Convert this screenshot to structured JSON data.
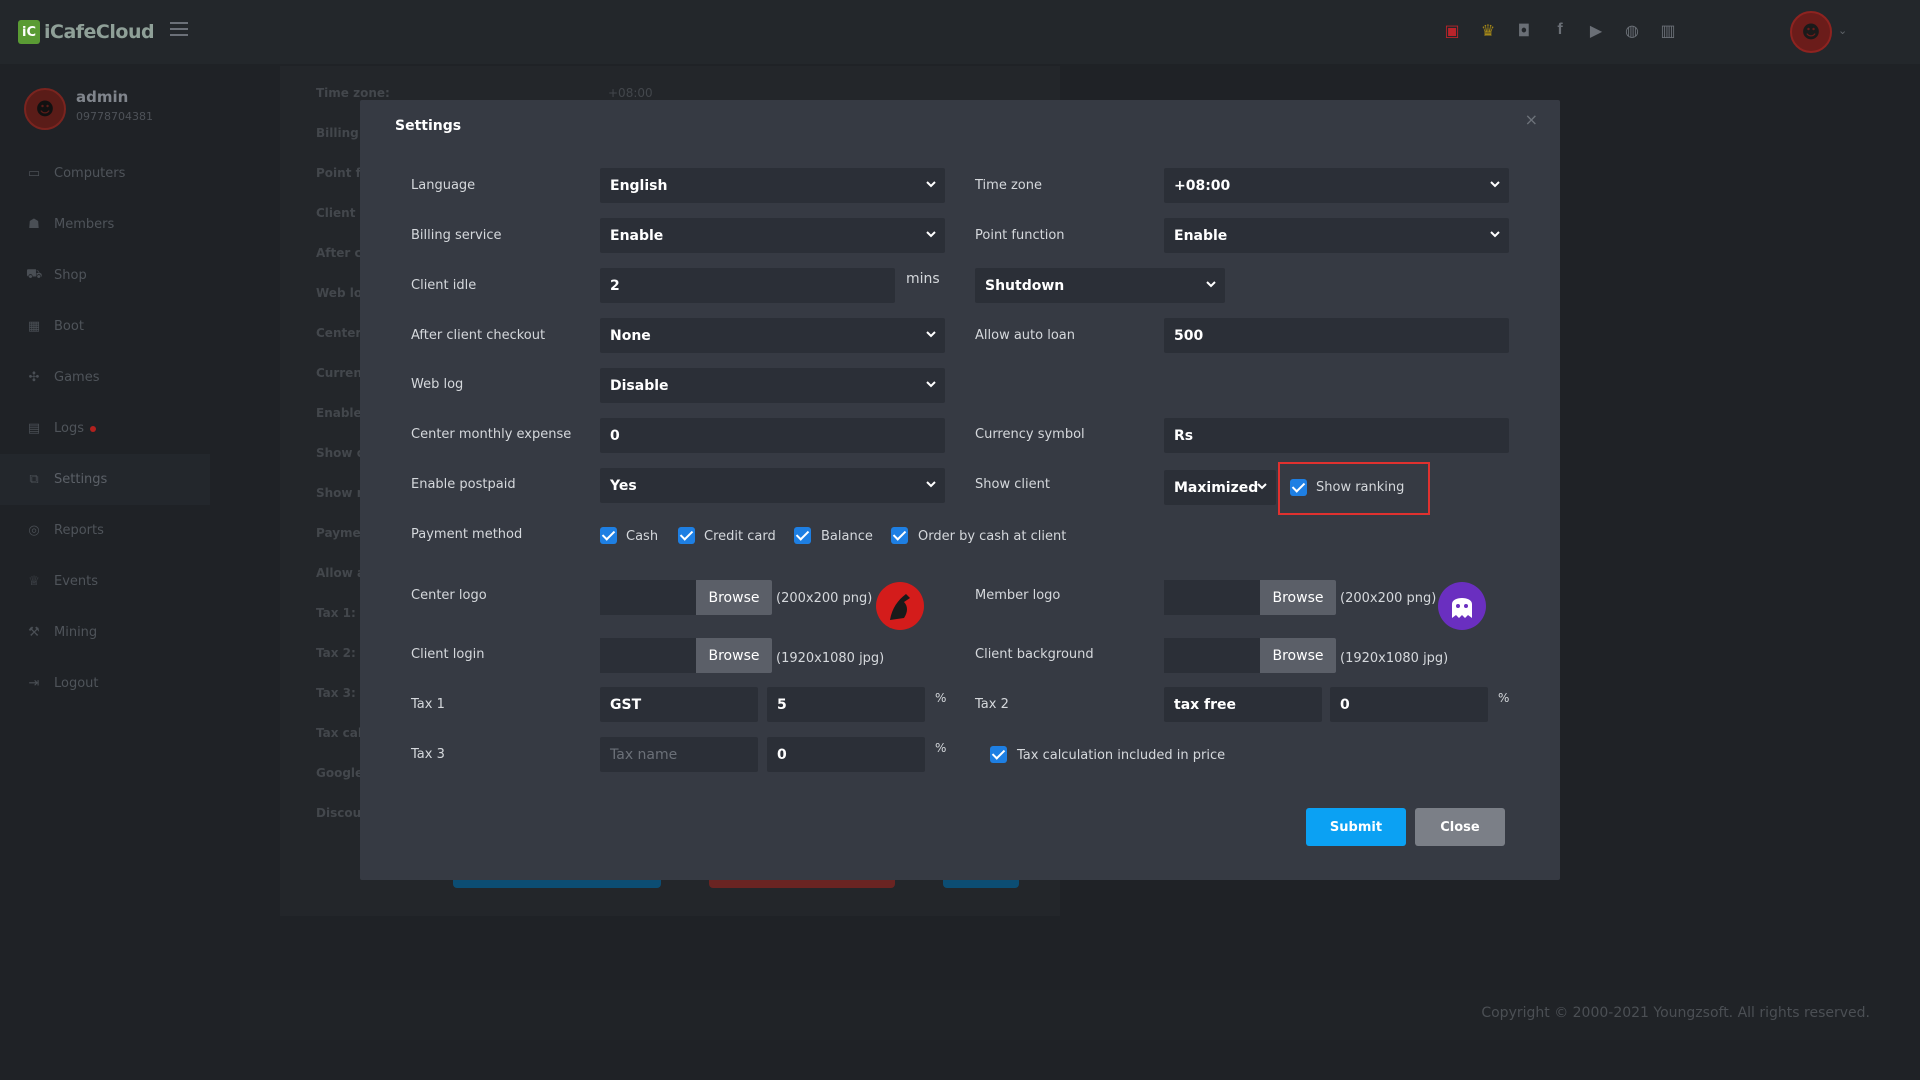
{
  "brand": {
    "logo_mark": "iC",
    "name": "iCafeCloud"
  },
  "topbar": {
    "icons": [
      "gift-icon",
      "trophy-icon",
      "discord-icon",
      "facebook-icon",
      "youtube-icon",
      "globe-icon",
      "book-icon"
    ]
  },
  "user": {
    "name": "admin",
    "phone": "09778704381"
  },
  "sidebar": {
    "items": [
      {
        "label": "Computers",
        "icon": "monitor-icon"
      },
      {
        "label": "Members",
        "icon": "users-icon"
      },
      {
        "label": "Shop",
        "icon": "cart-icon"
      },
      {
        "label": "Boot",
        "icon": "windows-icon"
      },
      {
        "label": "Games",
        "icon": "gamepad-icon"
      },
      {
        "label": "Logs",
        "icon": "calendar-icon"
      },
      {
        "label": "Settings",
        "icon": "settings-icon"
      },
      {
        "label": "Reports",
        "icon": "report-icon"
      },
      {
        "label": "Events",
        "icon": "crown-icon"
      },
      {
        "label": "Mining",
        "icon": "pickaxe-icon"
      },
      {
        "label": "Logout",
        "icon": "logout-icon"
      }
    ],
    "active": "Settings"
  },
  "background": {
    "labels": [
      "Time zone:",
      "Billing",
      "Point fu",
      "Client i",
      "After c",
      "Web lo",
      "Center",
      "Curren",
      "Enable",
      "Show c",
      "Show r",
      "Payme",
      "Allow a",
      "Tax 1:",
      "Tax 2:",
      "Tax 3:",
      "Tax cal",
      "Google",
      "Discou"
    ],
    "timezone_value": "+08:00"
  },
  "footer": {
    "copyright": "Copyright © 2000-2021 Youngzsoft. All rights reserved."
  },
  "modal": {
    "title": "Settings",
    "close_icon": "×",
    "language": {
      "label": "Language",
      "value": "English"
    },
    "timezone": {
      "label": "Time zone",
      "value": "+08:00"
    },
    "billing_service": {
      "label": "Billing service",
      "value": "Enable"
    },
    "point_function": {
      "label": "Point function",
      "value": "Enable"
    },
    "client_idle": {
      "label": "Client idle",
      "value": "2",
      "unit": "mins",
      "action": "Shutdown"
    },
    "after_checkout": {
      "label": "After client checkout",
      "value": "None"
    },
    "auto_loan": {
      "label": "Allow auto loan",
      "value": "500"
    },
    "web_log": {
      "label": "Web log",
      "value": "Disable"
    },
    "monthly_expense": {
      "label": "Center monthly expense",
      "value": "0"
    },
    "currency_symbol": {
      "label": "Currency symbol",
      "value": "Rs"
    },
    "postpaid": {
      "label": "Enable postpaid",
      "value": "Yes"
    },
    "show_client": {
      "label": "Show client",
      "value": "Maximized",
      "show_ranking_label": "Show ranking",
      "show_ranking_checked": true
    },
    "payment": {
      "label": "Payment method",
      "options": [
        {
          "label": "Cash",
          "checked": true
        },
        {
          "label": "Credit card",
          "checked": true
        },
        {
          "label": "Balance",
          "checked": true
        },
        {
          "label": "Order by cash at client",
          "checked": true
        }
      ]
    },
    "center_logo": {
      "label": "Center logo",
      "browse": "Browse",
      "hint": "(200x200 png)"
    },
    "member_logo": {
      "label": "Member logo",
      "browse": "Browse",
      "hint": "(200x200 png)"
    },
    "client_login": {
      "label": "Client login",
      "browse": "Browse",
      "hint": "(1920x1080 jpg)"
    },
    "client_background": {
      "label": "Client background",
      "browse": "Browse",
      "hint": "(1920x1080 jpg)"
    },
    "tax1": {
      "label": "Tax 1",
      "name": "GST",
      "rate": "5",
      "unit": "%"
    },
    "tax2": {
      "label": "Tax 2",
      "name": "tax free",
      "rate": "0",
      "unit": "%"
    },
    "tax3": {
      "label": "Tax 3",
      "name_placeholder": "Tax name",
      "rate": "0",
      "unit": "%"
    },
    "tax_included": {
      "label": "Tax calculation included in price",
      "checked": true
    },
    "submit": "Submit",
    "close": "Close"
  },
  "colors": {
    "accent": "#0ba1f3",
    "checkbox": "#1e7fe3",
    "highlight": "#e0312f",
    "modal_bg": "#363a43",
    "field_bg": "#2b2f37"
  }
}
